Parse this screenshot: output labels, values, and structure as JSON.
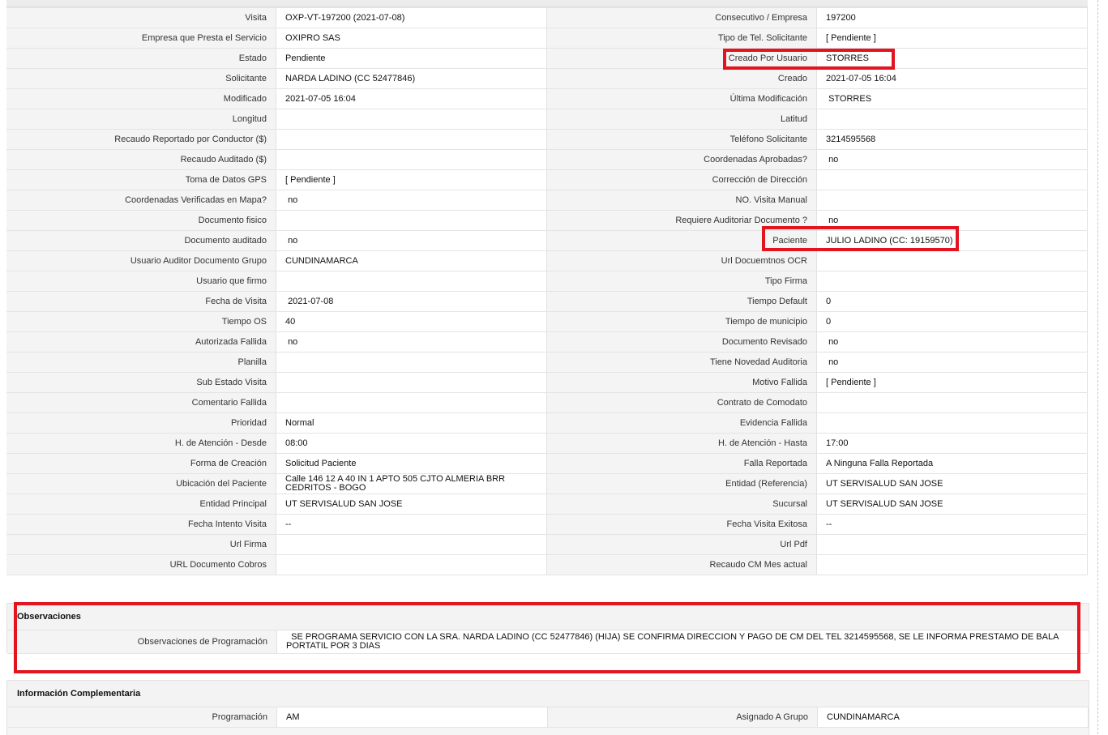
{
  "rows": [
    {
      "l1": "Visita",
      "v1": "OXP-VT-197200 (2021-07-08)",
      "l2": "Consecutivo / Empresa",
      "v2": "197200"
    },
    {
      "l1": "Empresa que Presta el Servicio",
      "v1": "OXIPRO SAS",
      "l2": "Tipo de Tel. Solicitante",
      "v2": "[ Pendiente ]"
    },
    {
      "l1": "Estado",
      "v1": "Pendiente",
      "l2": "Creado Por Usuario",
      "v2": "STORRES"
    },
    {
      "l1": "Solicitante",
      "v1": "NARDA LADINO (CC 52477846)",
      "l2": "Creado",
      "v2": "2021-07-05 16:04"
    },
    {
      "l1": "Modificado",
      "v1": "2021-07-05 16:04",
      "l2": "Última Modificación",
      "v2": " STORRES"
    },
    {
      "l1": "Longitud",
      "v1": "",
      "l2": "Latitud",
      "v2": ""
    },
    {
      "l1": "Recaudo Reportado por Conductor ($)",
      "v1": "",
      "l2": "Teléfono Solicitante",
      "v2": "3214595568"
    },
    {
      "l1": "Recaudo Auditado ($)",
      "v1": "",
      "l2": "Coordenadas Aprobadas?",
      "v2": " no"
    },
    {
      "l1": "Toma de Datos GPS",
      "v1": "[ Pendiente ]",
      "l2": "Corrección de Dirección",
      "v2": ""
    },
    {
      "l1": "Coordenadas Verificadas en Mapa?",
      "v1": " no",
      "l2": "NO. Visita Manual",
      "v2": ""
    },
    {
      "l1": "Documento fisico",
      "v1": "",
      "l2": "Requiere Auditoriar Documento ?",
      "v2": " no"
    },
    {
      "l1": "Documento auditado",
      "v1": " no",
      "l2": "Paciente",
      "v2": "JULIO LADINO (CC: 19159570)"
    },
    {
      "l1": "Usuario Auditor Documento Grupo",
      "v1": "CUNDINAMARCA",
      "l2": "Url Docuemtnos OCR",
      "v2": ""
    },
    {
      "l1": "Usuario que firmo",
      "v1": "",
      "l2": "Tipo Firma",
      "v2": ""
    },
    {
      "l1": "Fecha de Visita",
      "v1": " 2021-07-08",
      "l2": "Tiempo Default",
      "v2": "0"
    },
    {
      "l1": "Tiempo OS",
      "v1": "40",
      "l2": "Tiempo de municipio",
      "v2": "0"
    },
    {
      "l1": "Autorizada Fallida",
      "v1": " no",
      "l2": "Documento Revisado",
      "v2": " no"
    },
    {
      "l1": "Planilla",
      "v1": "",
      "l2": "Tiene Novedad Auditoria",
      "v2": " no"
    },
    {
      "l1": "Sub Estado Visita",
      "v1": "",
      "l2": "Motivo Fallida",
      "v2": "[ Pendiente ]"
    },
    {
      "l1": "Comentario Fallida",
      "v1": "",
      "l2": "Contrato de Comodato",
      "v2": ""
    },
    {
      "l1": "Prioridad",
      "v1": "Normal",
      "l2": "Evidencia Fallida",
      "v2": ""
    },
    {
      "l1": "H. de Atención - Desde",
      "v1": "08:00",
      "l2": "H. de Atención - Hasta",
      "v2": "17:00"
    },
    {
      "l1": "Forma de Creación",
      "v1": "Solicitud Paciente",
      "l2": "Falla Reportada",
      "v2": "A Ninguna Falla Reportada"
    },
    {
      "l1": "Ubicación del Paciente",
      "v1": "Calle 146 12 A 40 IN 1 APTO 505 CJTO ALMERIA BRR CEDRITOS - BOGO",
      "l2": "Entidad (Referencia)",
      "v2": "UT SERVISALUD SAN JOSE"
    },
    {
      "l1": "Entidad Principal",
      "v1": "UT SERVISALUD SAN JOSE",
      "l2": "Sucursal",
      "v2": "UT SERVISALUD SAN JOSE"
    },
    {
      "l1": "Fecha Intento Visita",
      "v1": "--",
      "l2": "Fecha Visita Exitosa",
      "v2": "--"
    },
    {
      "l1": "Url Firma",
      "v1": "",
      "l2": "Url Pdf",
      "v2": ""
    },
    {
      "l1": "URL Documento Cobros",
      "v1": "",
      "l2": "Recaudo CM Mes actual",
      "v2": ""
    }
  ],
  "observaciones": {
    "title": "Observaciones",
    "label": "Observaciones de Programación",
    "value": "  SE PROGRAMA SERVICIO CON LA SRA. NARDA LADINO (CC 52477846) (HIJA) SE CONFIRMA DIRECCION Y PAGO DE CM DEL TEL 3214595568, SE LE INFORMA PRESTAMO DE BALA PORTATIL POR 3 DIAS"
  },
  "complementaria": {
    "title": "Información Complementaria",
    "l1": "Programación",
    "v1": "AM",
    "l2": "Asignado A Grupo",
    "v2": "CUNDINAMARCA"
  },
  "colors": {
    "highlight": "#e3141f",
    "label_bg": "#f4f4f4",
    "border": "#e2e2e2"
  }
}
